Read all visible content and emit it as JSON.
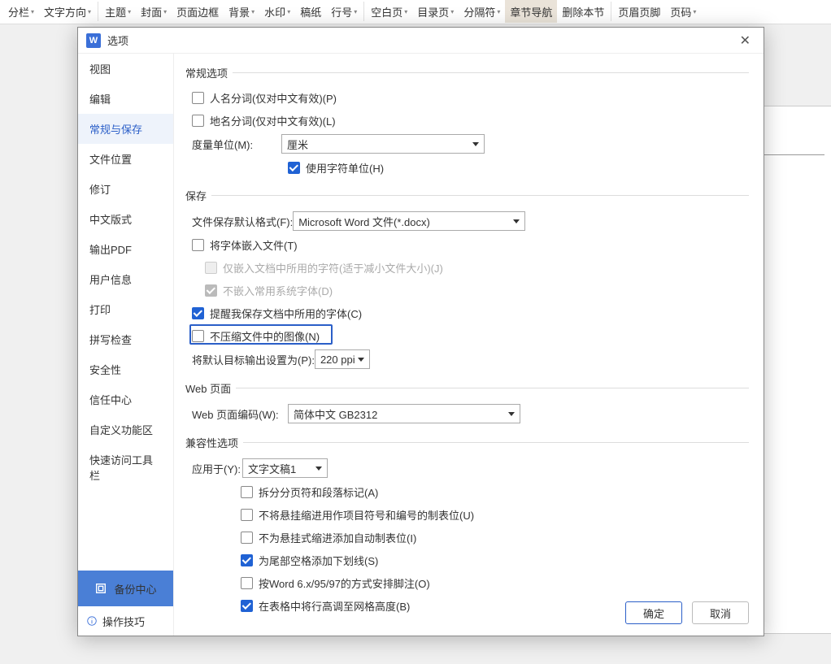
{
  "ribbon": [
    {
      "label": "分栏",
      "drop": true
    },
    {
      "label": "文字方向",
      "drop": true
    },
    {
      "sep": true
    },
    {
      "label": "主题",
      "drop": true
    },
    {
      "label": "封面",
      "drop": true
    },
    {
      "label": "页面边框"
    },
    {
      "label": "背景",
      "drop": true
    },
    {
      "label": "水印",
      "drop": true
    },
    {
      "label": "稿纸"
    },
    {
      "label": "行号",
      "drop": true
    },
    {
      "sep": true
    },
    {
      "label": "空白页",
      "drop": true
    },
    {
      "label": "目录页",
      "drop": true
    },
    {
      "label": "分隔符",
      "drop": true
    },
    {
      "label": "章节导航",
      "sel": true
    },
    {
      "label": "删除本节",
      "disabled": true
    },
    {
      "sep": true
    },
    {
      "label": "页眉页脚"
    },
    {
      "label": "页码",
      "drop": true
    }
  ],
  "dialog": {
    "title": "选项"
  },
  "sidebar": {
    "items": [
      {
        "key": "view",
        "label": "视图"
      },
      {
        "key": "edit",
        "label": "编辑"
      },
      {
        "key": "general",
        "label": "常规与保存",
        "active": true
      },
      {
        "key": "fileloc",
        "label": "文件位置"
      },
      {
        "key": "rev",
        "label": "修订"
      },
      {
        "key": "cjk",
        "label": "中文版式"
      },
      {
        "key": "pdf",
        "label": "输出PDF"
      },
      {
        "key": "user",
        "label": "用户信息"
      },
      {
        "key": "print",
        "label": "打印"
      },
      {
        "key": "spell",
        "label": "拼写检查"
      },
      {
        "key": "sec",
        "label": "安全性"
      },
      {
        "key": "trust",
        "label": "信任中心"
      },
      {
        "key": "ribbon",
        "label": "自定义功能区"
      },
      {
        "key": "qat",
        "label": "快速访问工具栏"
      }
    ],
    "backup": "备份中心",
    "tip": "操作技巧"
  },
  "general": {
    "title": "常规选项",
    "personName": "人名分词(仅对中文有效)(P)",
    "placeName": "地名分词(仅对中文有效)(L)",
    "unitLabel": "度量单位(M):",
    "unitValue": "厘米",
    "useCharUnit": "使用字符单位(H)"
  },
  "save": {
    "title": "保存",
    "defaultFmtLabel": "文件保存默认格式(F):",
    "defaultFmtValue": "Microsoft Word 文件(*.docx)",
    "embedFont": "将字体嵌入文件(T)",
    "embedUsed": "仅嵌入文档中所用的字符(适于减小文件大小)(J)",
    "noSysFont": "不嵌入常用系统字体(D)",
    "remindFont": "提醒我保存文档中所用的字体(C)",
    "noCompress": "不压缩文件中的图像(N)",
    "targetOutLabel": "将默认目标输出设置为(P):",
    "targetOutValue": "220 ppi"
  },
  "web": {
    "title": "Web 页面",
    "encodingLabel": "Web 页面编码(W):",
    "encodingValue": "简体中文 GB2312"
  },
  "compat": {
    "title": "兼容性选项",
    "applyLabel": "应用于(Y):",
    "applyValue": "文字文稿1",
    "opts": [
      {
        "label": "拆分分页符和段落标记(A)",
        "checked": false
      },
      {
        "label": "不将悬挂缩进用作项目符号和编号的制表位(U)",
        "checked": false
      },
      {
        "label": "不为悬挂式缩进添加自动制表位(I)",
        "checked": false
      },
      {
        "label": "为尾部空格添加下划线(S)",
        "checked": true
      },
      {
        "label": "按Word 6.x/95/97的方式安排脚注(O)",
        "checked": false
      },
      {
        "label": "在表格中将行高调至网格高度(B)",
        "checked": true
      }
    ]
  },
  "footer": {
    "ok": "确定",
    "cancel": "取消"
  }
}
